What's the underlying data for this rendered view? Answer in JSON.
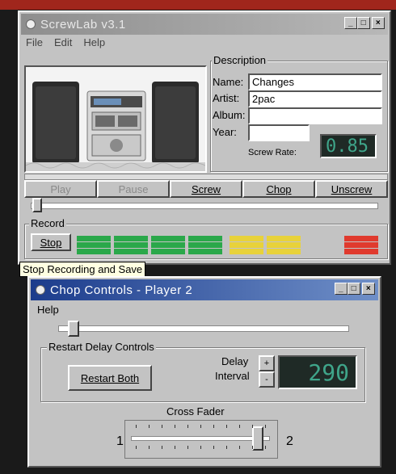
{
  "main_window": {
    "title": "ScrewLab v3.1",
    "controls": {
      "minimize": "_",
      "maximize": "□",
      "close": "×"
    },
    "menu": [
      "File",
      "Edit",
      "Help"
    ],
    "description": {
      "title": "Description",
      "name_label": "Name:",
      "name_value": "Changes",
      "artist_label": "Artist:",
      "artist_value": "2pac",
      "album_label": "Album:",
      "album_value": "",
      "year_label": "Year:",
      "year_value": "",
      "screw_rate_label": "Screw Rate:",
      "screw_rate_value": "0.85"
    },
    "transport": {
      "play": "Play",
      "pause": "Pause",
      "screw": "Screw",
      "chop": "Chop",
      "unscrew": "Unscrew"
    },
    "record": {
      "title": "Record",
      "stop": "Stop"
    },
    "meter_colors": {
      "green": "#2aa84a",
      "yellow": "#e8d23a",
      "red": "#e03a2e"
    }
  },
  "tooltip": "Stop Recording and Save",
  "chop_window": {
    "title": "Chop Controls - Player 2",
    "controls": {
      "minimize": "_",
      "maximize": "□",
      "close": "×"
    },
    "menu": [
      "Help"
    ],
    "restart_group": {
      "title": "Restart Delay Controls",
      "restart_button": "Restart Both",
      "delay_label_1": "Delay",
      "delay_label_2": "Interval",
      "up": "+",
      "down": "-",
      "delay_value": "290"
    },
    "cross_fader": {
      "title": "Cross Fader",
      "left_label": "1",
      "right_label": "2",
      "position": 0.95
    }
  }
}
